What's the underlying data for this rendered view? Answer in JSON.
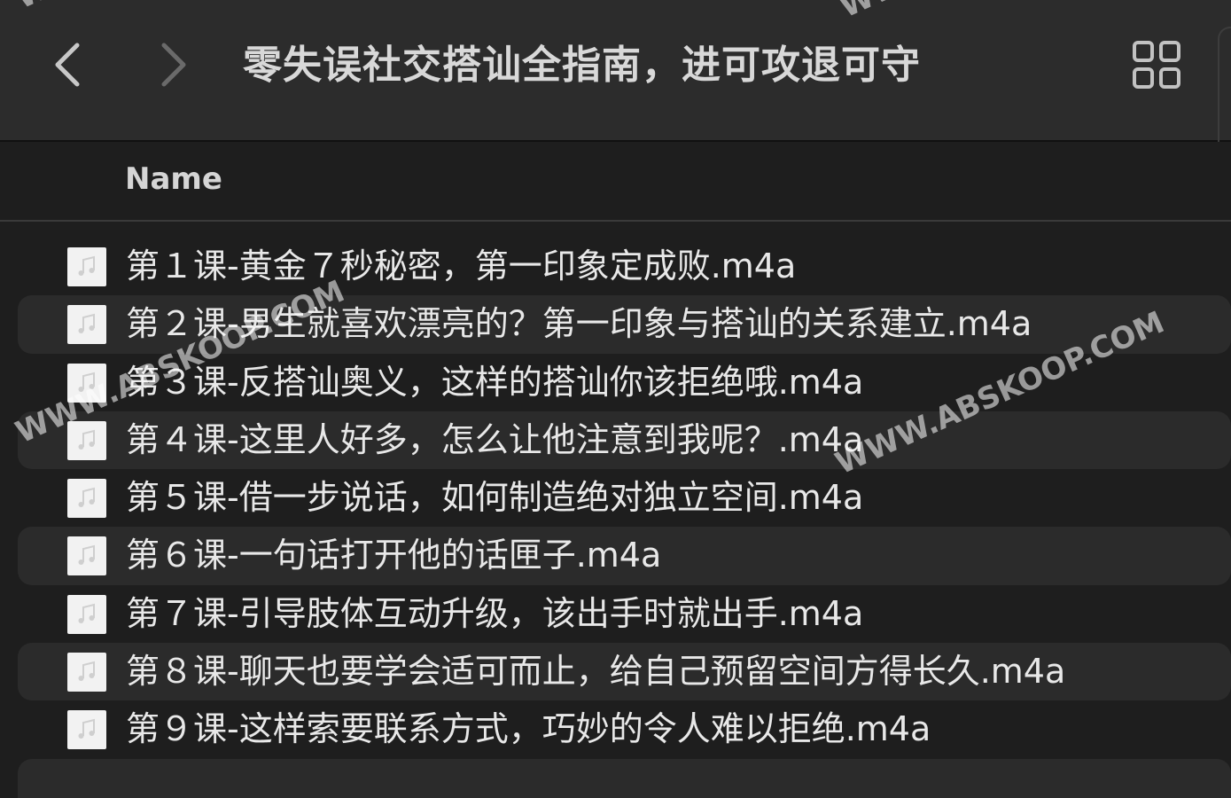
{
  "window": {
    "title": "零失误社交搭讪全指南，进可攻退可守"
  },
  "toolbar": {
    "back_icon": "chevron-left-icon",
    "forward_icon": "chevron-right-icon",
    "view_icon": "grid-view-icon"
  },
  "list": {
    "column_header": "Name",
    "files": [
      {
        "name": "第１课-黄金７秒秘密，第一印象定成败.m4a",
        "icon": "audio-file-icon"
      },
      {
        "name": "第２课-男生就喜欢漂亮的？第一印象与搭讪的关系建立.m4a",
        "icon": "audio-file-icon"
      },
      {
        "name": "第３课-反搭讪奥义，这样的搭讪你该拒绝哦.m4a",
        "icon": "audio-file-icon"
      },
      {
        "name": "第４课-这里人好多，怎么让他注意到我呢？.m4a",
        "icon": "audio-file-icon"
      },
      {
        "name": "第５课-借一步说话，如何制造绝对独立空间.m4a",
        "icon": "audio-file-icon"
      },
      {
        "name": "第６课-一句话打开他的话匣子.m4a",
        "icon": "audio-file-icon"
      },
      {
        "name": "第７课-引导肢体互动升级，该出手时就出手.m4a",
        "icon": "audio-file-icon"
      },
      {
        "name": "第８课-聊天也要学会适可而止，给自己预留空间方得长久.m4a",
        "icon": "audio-file-icon"
      },
      {
        "name": "第９课-这样索要联系方式，巧妙的令人难以拒绝.m4a",
        "icon": "audio-file-icon"
      }
    ]
  },
  "watermarks": {
    "text_left": "WWW.ABSKOOP.COM",
    "text_right": "WWW.ABSKOOP.COM",
    "text_top_left": "WWW",
    "text_top_right": "WWW"
  },
  "colors": {
    "background": "#1e1e1e",
    "toolbar": "#2c2c2c",
    "row_alt": "#2b2b2b",
    "text": "#e8e8e8"
  }
}
